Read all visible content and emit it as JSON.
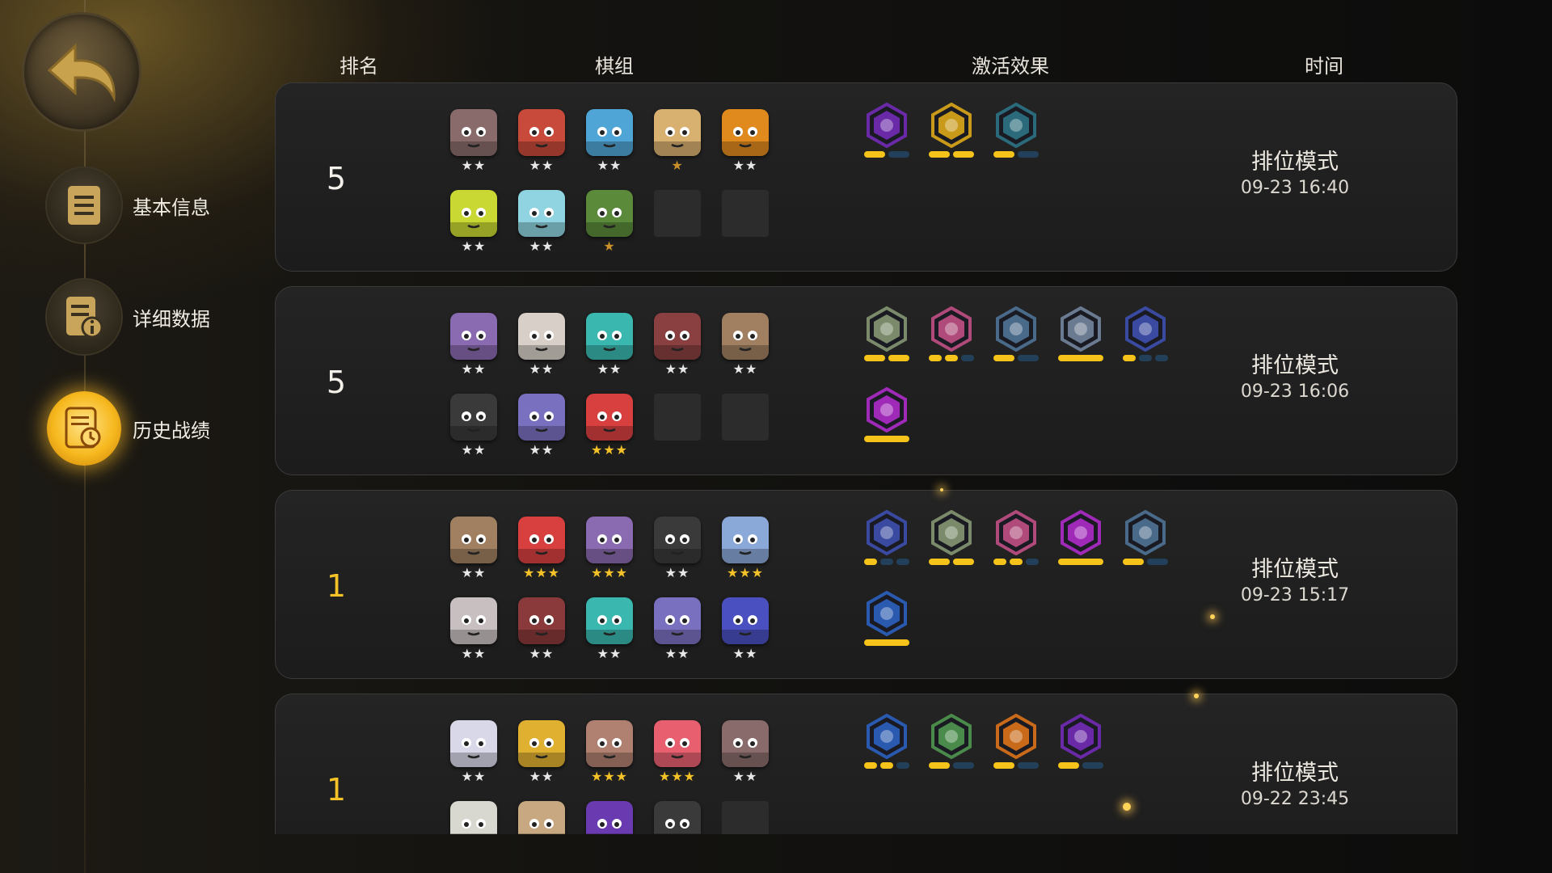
{
  "headers": {
    "rank": "排名",
    "lineup": "棋组",
    "traits": "激活效果",
    "time": "时间"
  },
  "sidebar": {
    "back_icon": "back-arrow-icon",
    "items": [
      {
        "label": "基本信息",
        "icon": "document-icon",
        "active": false
      },
      {
        "label": "详细数据",
        "icon": "data-info-icon",
        "active": false
      },
      {
        "label": "历史战绩",
        "icon": "history-clock-icon",
        "active": true
      }
    ]
  },
  "colors": {
    "gold": "#f5c227",
    "bar_on": "#f5c31a",
    "bar_off": "#23405a"
  },
  "records": [
    {
      "rank": "5",
      "mode": "排位模式",
      "time": "09-23 16:40",
      "pieces": [
        {
          "color": "#8a6b6b",
          "stars": 2
        },
        {
          "color": "#c84a3a",
          "stars": 2
        },
        {
          "color": "#4fa6d6",
          "stars": 2
        },
        {
          "color": "#d8b070",
          "stars": 1
        },
        {
          "color": "#e08a1e",
          "stars": 2
        },
        {
          "color": "#c9d832",
          "stars": 2
        },
        {
          "color": "#8fd4e0",
          "stars": 2
        },
        {
          "color": "#5b8a3a",
          "stars": 1
        },
        null,
        null
      ],
      "traits": [
        {
          "color": "#6a2aa8",
          "on": 1,
          "total": 2
        },
        {
          "color": "#c99a1a",
          "on": 2,
          "total": 2
        },
        {
          "color": "#2a6a7a",
          "on": 1,
          "total": 2
        }
      ]
    },
    {
      "rank": "5",
      "mode": "排位模式",
      "time": "09-23 16:06",
      "pieces": [
        {
          "color": "#8a6ab0",
          "stars": 2
        },
        {
          "color": "#d8d0c8",
          "stars": 2
        },
        {
          "color": "#3ab8b0",
          "stars": 2
        },
        {
          "color": "#8a4040",
          "stars": 2
        },
        {
          "color": "#a08060",
          "stars": 2
        },
        {
          "color": "#3a3a3a",
          "stars": 2
        },
        {
          "color": "#7a70c0",
          "stars": 2
        },
        {
          "color": "#d84040",
          "stars": 3
        },
        null,
        null
      ],
      "traits": [
        {
          "color": "#7a8a6a",
          "on": 2,
          "total": 2
        },
        {
          "color": "#b04a7a",
          "on": 2,
          "total": 3
        },
        {
          "color": "#4a6a8a",
          "on": 1,
          "total": 2
        },
        {
          "color": "#6a7a90",
          "on": 1,
          "total": 1
        },
        {
          "color": "#3a4aa0",
          "on": 1,
          "total": 3
        },
        {
          "color": "#a02ab8",
          "on": 1,
          "total": 1
        }
      ]
    },
    {
      "rank": "1",
      "mode": "排位模式",
      "time": "09-23 15:17",
      "pieces": [
        {
          "color": "#a08060",
          "stars": 2
        },
        {
          "color": "#d84040",
          "stars": 3
        },
        {
          "color": "#8a6ab0",
          "stars": 3
        },
        {
          "color": "#3a3a3a",
          "stars": 2
        },
        {
          "color": "#8aa8d8",
          "stars": 3
        },
        {
          "color": "#c8c0c0",
          "stars": 2
        },
        {
          "color": "#8a3a3a",
          "stars": 2
        },
        {
          "color": "#3ab8b0",
          "stars": 2
        },
        {
          "color": "#7a70c0",
          "stars": 2
        },
        {
          "color": "#4a50c0",
          "stars": 2
        }
      ],
      "traits": [
        {
          "color": "#3a4aa0",
          "on": 1,
          "total": 3
        },
        {
          "color": "#7a8a6a",
          "on": 2,
          "total": 2
        },
        {
          "color": "#b04a7a",
          "on": 2,
          "total": 3
        },
        {
          "color": "#a02ab8",
          "on": 1,
          "total": 1
        },
        {
          "color": "#4a6a8a",
          "on": 1,
          "total": 2
        },
        {
          "color": "#2a5ab0",
          "on": 1,
          "total": 1
        }
      ]
    },
    {
      "rank": "1",
      "mode": "排位模式",
      "time": "09-22 23:45",
      "pieces": [
        {
          "color": "#d8d8e8",
          "stars": 2
        },
        {
          "color": "#e0b030",
          "stars": 2
        },
        {
          "color": "#b08070",
          "stars": 3
        },
        {
          "color": "#e86070",
          "stars": 3
        },
        {
          "color": "#8a6b6b",
          "stars": 2
        },
        {
          "color": "#d8d8d0",
          "stars": 0
        },
        {
          "color": "#c8a880",
          "stars": 0
        },
        {
          "color": "#6a3ab0",
          "stars": 0
        },
        {
          "color": "#3a3a3a",
          "stars": 0
        },
        null
      ],
      "traits": [
        {
          "color": "#2a5ab0",
          "on": 2,
          "total": 3
        },
        {
          "color": "#4a8a4a",
          "on": 1,
          "total": 2
        },
        {
          "color": "#c86a1a",
          "on": 1,
          "total": 2
        },
        {
          "color": "#6a2aa8",
          "on": 1,
          "total": 2
        }
      ]
    }
  ]
}
